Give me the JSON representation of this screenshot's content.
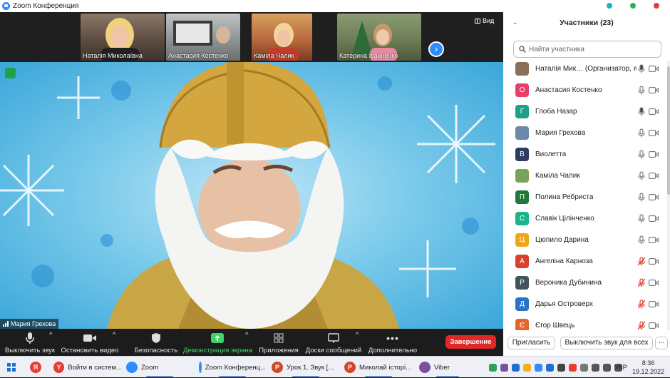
{
  "window": {
    "title": "Zoom Конференция",
    "controls": [
      {
        "name": "minimize",
        "color": "#19b3c7"
      },
      {
        "name": "maximize",
        "color": "#2bb24c"
      },
      {
        "name": "close",
        "color": "#e03c3c"
      }
    ]
  },
  "gallery": {
    "thumbnails": [
      {
        "name": "Наталія Миколаївна",
        "icon": "video-feed",
        "bg": "#6c5b4c"
      },
      {
        "name": "Анастасия Костенко",
        "icon": "video-feed",
        "bg": "#8a8f90"
      },
      {
        "name": "Каміла Чалик",
        "icon": "video-feed",
        "bg": "#c07c49"
      },
      {
        "name": "Катерина Івахненко",
        "icon": "video-feed",
        "bg": "#6b7a54"
      }
    ],
    "next_icon": "chevron-right-icon",
    "view_label": "Вид"
  },
  "main_video": {
    "speaker_name": "Мария Грехова",
    "description_icon": "video-feed",
    "security_icon": "shield-check-icon"
  },
  "toolbar": {
    "buttons": [
      {
        "label": "Выключить звук",
        "icon": "microphone-icon",
        "caret": true
      },
      {
        "label": "Остановить видео",
        "icon": "video-camera-icon",
        "caret": true
      },
      {
        "label": "Безопасность",
        "icon": "shield-icon",
        "caret": false
      },
      {
        "label": "Демонстрация экрана",
        "icon": "share-screen-icon",
        "caret": true,
        "accent": "#3fd36b"
      },
      {
        "label": "Приложения",
        "icon": "apps-icon",
        "caret": false
      },
      {
        "label": "Доски сообщений",
        "icon": "whiteboard-icon",
        "caret": true
      },
      {
        "label": "Дополнительно",
        "icon": "more-dots-icon",
        "caret": false
      }
    ],
    "end_label": "Завершение",
    "end_color": "#e02828"
  },
  "participants": {
    "title": "Участники (23)",
    "collapse_icon": "chevron-down-icon",
    "search_placeholder": "Найти участника",
    "list": [
      {
        "name": "Наталія Мик… (Организатор, я)",
        "initial": "",
        "avatar_color": "#8a6f5d",
        "photo": true,
        "mic": "on-active",
        "cam": "off"
      },
      {
        "name": "Анастасия Костенко",
        "initial": "О",
        "avatar_color": "#e83e6c",
        "photo": false,
        "mic": "on",
        "cam": "off"
      },
      {
        "name": "Глоба Назар",
        "initial": "Г",
        "avatar_color": "#1da08a",
        "photo": false,
        "mic": "on-active",
        "cam": "off"
      },
      {
        "name": "Мария Грехова",
        "initial": "",
        "avatar_color": "#6d88aa",
        "photo": true,
        "mic": "on",
        "cam": "off"
      },
      {
        "name": "Виолетта",
        "initial": "В",
        "avatar_color": "#2c3e62",
        "photo": false,
        "mic": "on",
        "cam": "off"
      },
      {
        "name": "Каміла Чалик",
        "initial": "",
        "avatar_color": "#7aa35a",
        "photo": true,
        "mic": "on",
        "cam": "off"
      },
      {
        "name": "Полина Ребриста",
        "initial": "П",
        "avatar_color": "#1f7a3a",
        "photo": false,
        "mic": "on",
        "cam": "off"
      },
      {
        "name": "Славік Цілінченко",
        "initial": "С",
        "avatar_color": "#1bb58c",
        "photo": false,
        "mic": "on",
        "cam": "off"
      },
      {
        "name": "Цюпило Дарина",
        "initial": "Ц",
        "avatar_color": "#f2a51a",
        "photo": false,
        "mic": "on",
        "cam": "off"
      },
      {
        "name": "Ангеліна Карноза",
        "initial": "А",
        "avatar_color": "#d9412f",
        "photo": false,
        "mic": "muted",
        "cam": "off"
      },
      {
        "name": "Вероника Дубинина",
        "initial": "Р",
        "avatar_color": "#3e5660",
        "photo": false,
        "mic": "muted",
        "cam": "off"
      },
      {
        "name": "Дарья Островерх",
        "initial": "Д",
        "avatar_color": "#2a73c8",
        "photo": false,
        "mic": "muted",
        "cam": "off"
      },
      {
        "name": "Єгор Швець",
        "initial": "Є",
        "avatar_color": "#e8632a",
        "photo": false,
        "mic": "muted",
        "cam": "off"
      }
    ],
    "invite_label": "Пригласить",
    "mute_all_label": "Выключить звук для всех",
    "more_label": "..."
  },
  "taskbar": {
    "items": [
      {
        "label": "",
        "icon": "windows-start-icon",
        "color": "#1f6fd1"
      },
      {
        "label": "",
        "icon": "yandex-browser-icon",
        "color": "#e83d2f",
        "text": "Я"
      },
      {
        "label": "Войти в систем...",
        "icon": "yandex-icon",
        "color": "#e83d2f",
        "text": "Y"
      },
      {
        "label": "Zoom",
        "icon": "zoom-icon",
        "color": "#2d8cff",
        "text": ""
      },
      {
        "label": "Zoom Конференц...",
        "icon": "zoom-icon",
        "color": "#2d8cff",
        "text": ""
      },
      {
        "label": "Урок 1. Звук [...",
        "icon": "powerpoint-icon",
        "color": "#d24726",
        "text": "P"
      },
      {
        "label": "Миколай історі...",
        "icon": "powerpoint-icon",
        "color": "#d24726",
        "text": "P"
      },
      {
        "label": "Viber",
        "icon": "viber-icon",
        "color": "#7b519d",
        "text": ""
      }
    ],
    "language": "УКР",
    "time": "8:36",
    "date": "19.12.2022"
  }
}
